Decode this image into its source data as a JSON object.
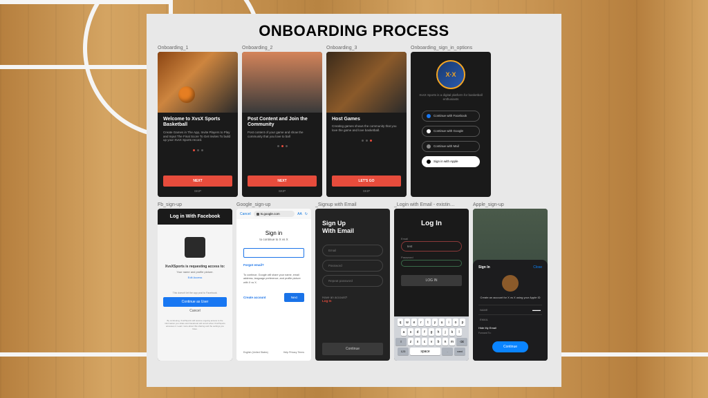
{
  "title": "ONBOARDING PROCESS",
  "row1": {
    "s1": {
      "label": "Onboarding_1",
      "heading": "Welcome to XvsX Sports Basketball",
      "sub": "Create Games in The App, Invite Players to Play and Input The Final Score To Get Invites To build up your XvsX Sports record.",
      "cta": "NEXT",
      "skip": "SKIP"
    },
    "s2": {
      "label": "Onboarding_2",
      "heading": "Post Content and Join the Community",
      "sub": "Post content of your game and show the community that you love to ball",
      "cta": "NEXT",
      "skip": "SKIP"
    },
    "s3": {
      "label": "Onboarding_3",
      "heading": "Host Games",
      "sub": "Creating games shows the community that you love the game and love basketball.",
      "cta": "LET'S GO",
      "skip": "SKIP"
    },
    "s4": {
      "label": "Onboarding_sign_in_options",
      "logo_text": "X·X",
      "tag": "XvsX Sports is a digital platform for basketball enthusiasts",
      "fb": "Continue with Facebook",
      "gg": "Continue with Google",
      "ml": "Continue with Mail",
      "ap": "Sign in with Apple"
    }
  },
  "row2": {
    "fb": {
      "label": "Fb_sign-up",
      "title": "Log in With Facebook",
      "req": "XvsXSports is requesting access to:",
      "scope": "Your name and profile picture.",
      "edit": "Edit Access",
      "note": "This doesn't let the app post to Facebook.",
      "btn": "Continue as User",
      "cancel": "Cancel",
      "foot": "By continuing, XvsXSports will receive ongoing access to the information you share and Facebook will record when XvsXSports accesses it. Learn more about this sharing and the settings you have."
    },
    "gg": {
      "label": "Google_sign-up",
      "cancel": "Cancel",
      "url": "ts.google.com",
      "heading": "Sign in",
      "sub": "to continue to X vs X",
      "forgot": "Forgot email?",
      "info": "To continue, Google will share your name, email address, language preference, and profile picture with X vs X.",
      "create": "Create account",
      "next": "Next",
      "lang": "English (United States)",
      "links": "Help   Privacy   Terms"
    },
    "em": {
      "label": "_Signup with Email",
      "heading": "Sign Up\nWith Email",
      "p_email": "Email",
      "p_pass": "Password",
      "p_rpass": "Repeat password",
      "have": "Have an account?",
      "login": "Log In",
      "cta": "Continue"
    },
    "lg": {
      "label": "_Login with Email - existin…",
      "heading": "Log In",
      "l_email": "Email",
      "v_email": "test",
      "l_pass": "Password",
      "cta": "LOG IN",
      "kb_space": "space",
      "kb_next": "next",
      "kb_123": "123"
    },
    "ap": {
      "label": "Apple_sign-up",
      "signin": "Sign In",
      "close": "Close",
      "msg": "Create an account for X vs X using your Apple ID",
      "name_l": "NAME",
      "email_l": "EMAIL",
      "hide": "Hide My Email",
      "fwd": "Forward To:",
      "btn": "Continue"
    }
  }
}
